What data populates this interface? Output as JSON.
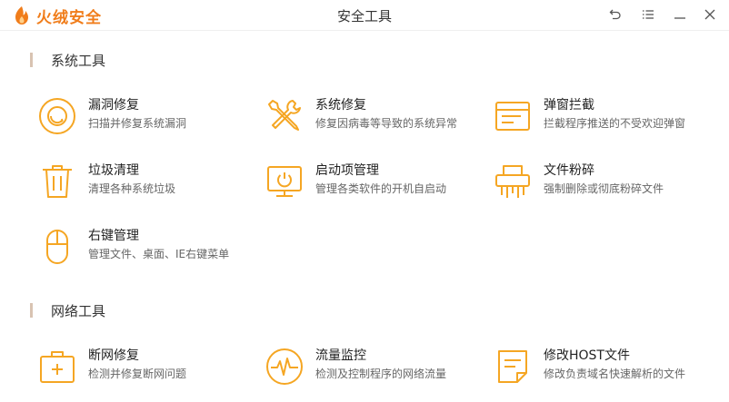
{
  "brand": {
    "name": "火绒安全",
    "accent": "#f07d1b"
  },
  "window": {
    "title": "安全工具"
  },
  "controls": [
    {
      "icon": "back-arrow-icon"
    },
    {
      "icon": "menu-icon"
    },
    {
      "icon": "minimize-icon"
    },
    {
      "icon": "close-icon"
    }
  ],
  "sections": [
    {
      "title": "系统工具",
      "tools": [
        {
          "name": "漏洞修复",
          "desc": "扫描并修复系统漏洞",
          "icon": "vulnerability-repair-icon"
        },
        {
          "name": "系统修复",
          "desc": "修复因病毒等导致的系统异常",
          "icon": "wrench-screwdriver-icon"
        },
        {
          "name": "弹窗拦截",
          "desc": "拦截程序推送的不受欢迎弹窗",
          "icon": "popup-window-icon"
        },
        {
          "name": "垃圾清理",
          "desc": "清理各种系统垃圾",
          "icon": "trash-can-icon"
        },
        {
          "name": "启动项管理",
          "desc": "管理各类软件的开机自启动",
          "icon": "monitor-power-icon"
        },
        {
          "name": "文件粉碎",
          "desc": "强制删除或彻底粉碎文件",
          "icon": "shredder-icon"
        },
        {
          "name": "右键管理",
          "desc": "管理文件、桌面、IE右键菜单",
          "icon": "mouse-icon"
        }
      ]
    },
    {
      "title": "网络工具",
      "tools": [
        {
          "name": "断网修复",
          "desc": "检测并修复断网问题",
          "icon": "first-aid-kit-icon"
        },
        {
          "name": "流量监控",
          "desc": "检测及控制程序的网络流量",
          "icon": "traffic-pulse-icon"
        },
        {
          "name": "修改HOST文件",
          "desc": "修改负责域名快速解析的文件",
          "icon": "host-file-icon"
        }
      ]
    }
  ]
}
